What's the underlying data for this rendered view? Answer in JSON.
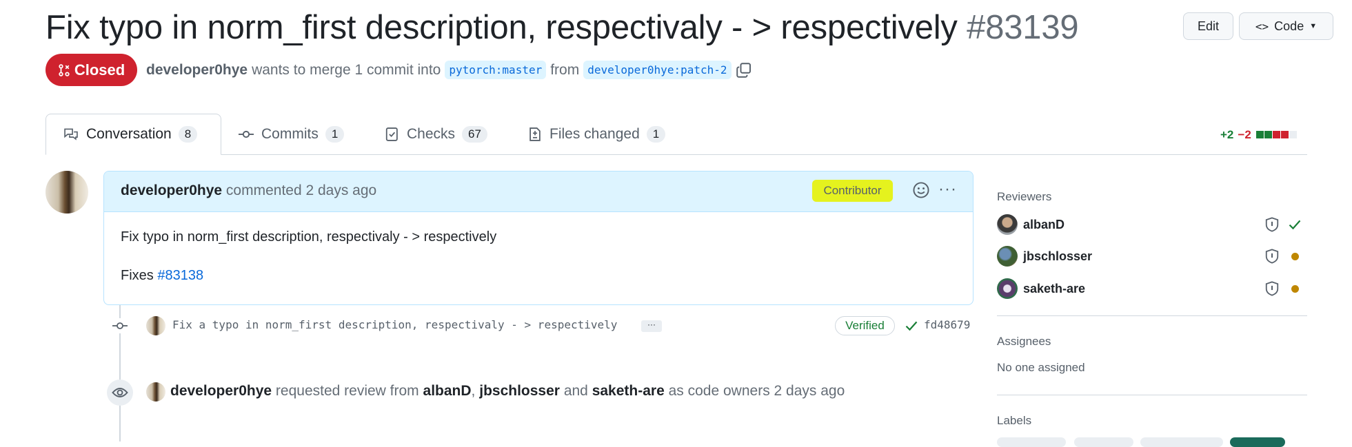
{
  "header": {
    "title": "Fix typo in norm_first description, respectivaly - > respectively",
    "number": "#83139",
    "edit_label": "Edit",
    "code_label": "Code",
    "state_label": "Closed",
    "author": "developer0hye",
    "merge_text": "wants to merge 1 commit into",
    "base_branch": "pytorch:master",
    "from_text": "from",
    "head_branch": "developer0hye:patch-2"
  },
  "tabs": [
    {
      "label": "Conversation",
      "count": "8"
    },
    {
      "label": "Commits",
      "count": "1"
    },
    {
      "label": "Checks",
      "count": "67"
    },
    {
      "label": "Files changed",
      "count": "1"
    }
  ],
  "diffstat": {
    "additions": "+2",
    "deletions": "−2"
  },
  "comment": {
    "author": "developer0hye",
    "action": "commented 2 days ago",
    "badge": "Contributor",
    "body": "Fix typo in norm_first description, respectivaly - > respectively",
    "fixes_prefix": "Fixes",
    "fixes_link": "#83138"
  },
  "commit": {
    "message": "Fix a typo in norm_first description, respectivaly - > respectively",
    "ellipsis": "···",
    "verified_label": "Verified",
    "sha": "fd48679"
  },
  "review_event": {
    "actor": "developer0hye",
    "text1": "requested review from",
    "reviewer1": "albanD",
    "sep": ",",
    "reviewer2": "jbschlosser",
    "and": "and",
    "reviewer3": "saketh-are",
    "text2": "as code owners 2 days ago"
  },
  "sidebar": {
    "reviewers_heading": "Reviewers",
    "reviewers": [
      {
        "name": "albanD",
        "status": "approved"
      },
      {
        "name": "jbschlosser",
        "status": "pending"
      },
      {
        "name": "saketh-are",
        "status": "pending"
      }
    ],
    "assignees_heading": "Assignees",
    "assignees_value": "No one assigned",
    "labels_heading": "Labels"
  },
  "colors": {
    "accent": "#0969da",
    "closed": "#cf222e",
    "success": "#1a7f37",
    "pending": "#bf8700",
    "highlight": "#e5f21e"
  }
}
